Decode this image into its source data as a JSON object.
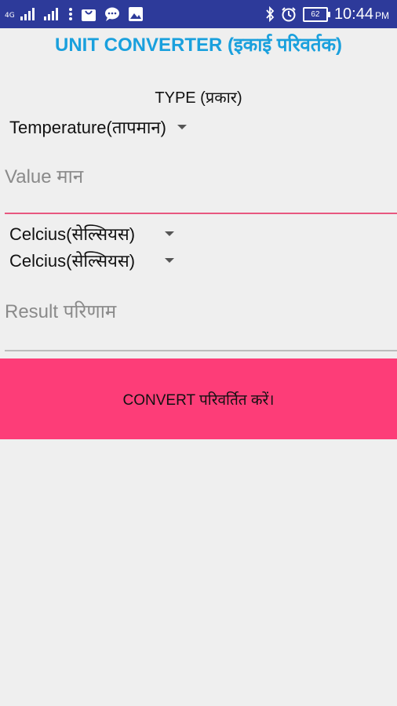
{
  "status_bar": {
    "network_label": "4G",
    "time": "10:44",
    "ampm": "PM",
    "battery_level": "62",
    "icons": [
      "signal-icon",
      "signal-icon",
      "more-icon",
      "shopping-bag-icon",
      "chat-icon",
      "image-icon",
      "bluetooth-icon",
      "alarm-icon",
      "battery-icon"
    ]
  },
  "app": {
    "title": "UNIT CONVERTER (इकाई परिवर्तक)",
    "accent_color": "#1aa0dd",
    "button_color": "#fd3d78"
  },
  "form": {
    "type_label": "TYPE (प्रकार)",
    "type_selected": "Temperature(तापमान)",
    "value_placeholder": "Value मान",
    "from_unit": "Celcius(सेल्सियस)",
    "to_unit": "Celcius(सेल्सियस)",
    "result_placeholder": "Result परिणाम",
    "convert_label": "CONVERT परिवर्तित करें।"
  }
}
